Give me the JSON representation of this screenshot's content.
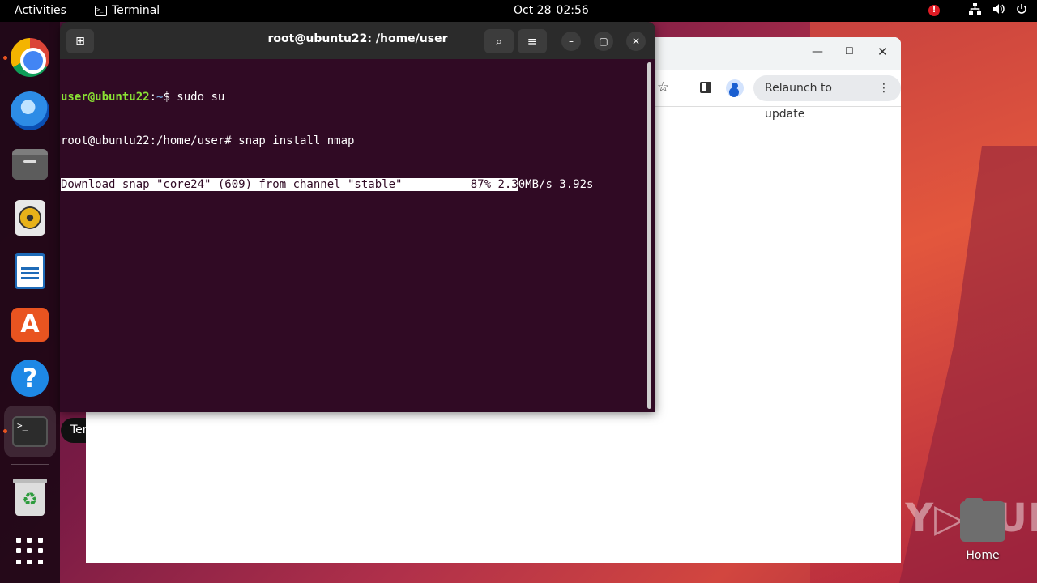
{
  "topbar": {
    "activities": "Activities",
    "app_name": "Terminal",
    "app_icon_glyph": ">_",
    "date": "Oct 28",
    "time": "02:56",
    "alert_glyph": "!",
    "icons": [
      "network-icon",
      "volume-icon",
      "power-icon"
    ]
  },
  "dock": {
    "items": [
      {
        "name": "google-chrome",
        "running": true
      },
      {
        "name": "thunderbird",
        "running": false
      },
      {
        "name": "files",
        "running": false
      },
      {
        "name": "rhythmbox",
        "running": false
      },
      {
        "name": "libreoffice-writer",
        "running": false
      },
      {
        "name": "ubuntu-software",
        "running": false
      },
      {
        "name": "help",
        "running": false
      },
      {
        "name": "terminal",
        "running": true
      },
      {
        "name": "trash",
        "running": false
      },
      {
        "name": "show-applications",
        "running": false
      }
    ],
    "store_glyph": "A",
    "help_glyph": "?",
    "terminal_glyph": ">_",
    "trash_glyph": "♻",
    "tooltip": "Terminal"
  },
  "browser": {
    "relaunch_label": "Relaunch to update",
    "menu_glyph": "⋮",
    "star_glyph": "☆",
    "min_glyph": "—",
    "max_glyph": "☐",
    "close_glyph": "✕"
  },
  "terminal": {
    "title": "root@ubuntu22: /home/user",
    "new_tab_glyph": "⊞",
    "search_glyph": "⌕",
    "menu_glyph": "≡",
    "min_glyph": "–",
    "max_glyph": "▢",
    "close_glyph": "✕",
    "lines": {
      "l1_user": "user@ubuntu22",
      "l1_sep": ":",
      "l1_path": "~",
      "l1_cmd": "$ sudo su",
      "l2": "root@ubuntu22:/home/user# snap install nmap",
      "l3_highlight": "Download snap \"core24\" (609) from channel \"stable\"          87% 2.3",
      "l3_rest": "0MB/s 3.92s"
    }
  },
  "desktop": {
    "home_label": "Home",
    "watermark": "ANY▷RUN"
  },
  "colors": {
    "terminal_bg": "#300a24",
    "prompt_user": "#8ae234",
    "prompt_path": "#729fcf",
    "accent": "#e95420"
  }
}
